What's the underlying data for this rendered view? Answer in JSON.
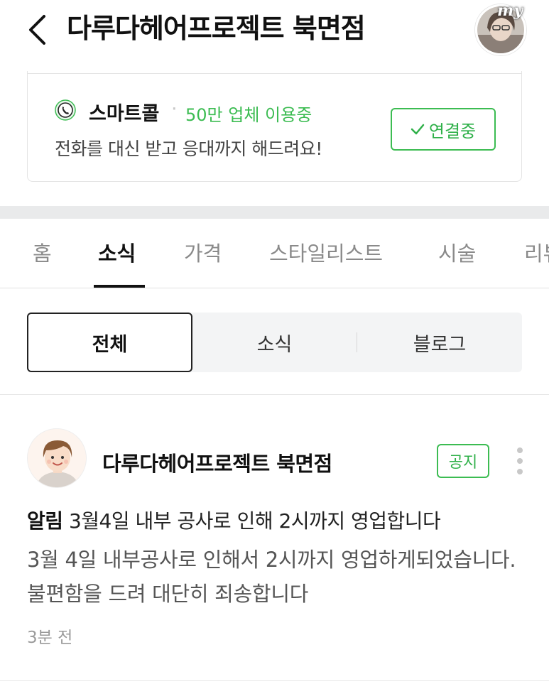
{
  "header": {
    "title": "다루다헤어프로젝트 북면점",
    "back_icon": "chevron-left-icon",
    "avatar_tag": "my"
  },
  "smartcall": {
    "icon": "phone-icon",
    "name": "스마트콜",
    "separator": "·",
    "users": "50만 업체 이용중",
    "description": "전화를 대신 받고 응대까지 해드려요!",
    "button_label": "연결중",
    "button_icon": "check-icon"
  },
  "tabs": [
    {
      "label": "홈",
      "active": false
    },
    {
      "label": "소식",
      "active": true
    },
    {
      "label": "가격",
      "active": false
    },
    {
      "label": "스타일리스트",
      "active": false
    },
    {
      "label": "시술",
      "active": false
    },
    {
      "label": "리뷰",
      "active": false
    }
  ],
  "filters": [
    {
      "label": "전체",
      "active": true
    },
    {
      "label": "소식",
      "active": false
    },
    {
      "label": "블로그",
      "active": false
    }
  ],
  "post": {
    "author": "다루다헤어프로젝트 북면점",
    "badge": "공지",
    "headline_prefix": "알림",
    "headline": "3월4일 내부 공사로 인해 2시까지 영업합니다",
    "body": "3월 4일 내부공사로 인해서 2시까지 영업하게되었습니다. 불편함을 드려 대단히 죄송합니다",
    "time": "3분 전"
  },
  "colors": {
    "accent_green": "#3cbc52",
    "text_primary": "#111111",
    "text_muted": "#8a8a8a"
  }
}
